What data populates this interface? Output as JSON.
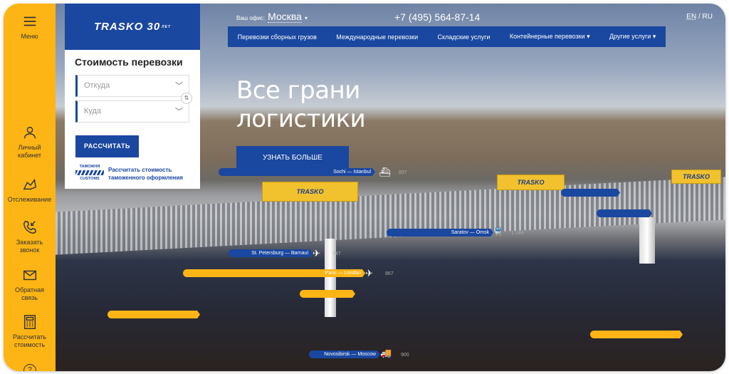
{
  "sidebar": {
    "menu": "Меню",
    "items": [
      {
        "label": "Личный кабинет",
        "icon": "user-icon"
      },
      {
        "label": "Отслеживание",
        "icon": "map-icon"
      },
      {
        "label": "Заказать звонок",
        "icon": "phone-icon"
      },
      {
        "label": "Обратная связь",
        "icon": "mail-icon"
      },
      {
        "label": "Рассчитать стоимость",
        "icon": "calculator-icon"
      }
    ],
    "help": "?"
  },
  "panel": {
    "logo": "TRASKO 30",
    "logo_sub": "ЛЕТ",
    "title": "Стоимость перевозки",
    "from_placeholder": "Откуда",
    "to_placeholder": "Куда",
    "calc_button": "РАССЧИТАТЬ",
    "customs_top": "ТАМОЖНЯ",
    "customs_bottom": "CUSTOMS",
    "customs_link": "Рассчитать стоимость таможенного оформления"
  },
  "header": {
    "office_label": "Ваш офис:",
    "office": "Москва",
    "phone": "+7 (495) 564-87-14",
    "lang_en": "EN",
    "lang_ru": "RU",
    "nav": [
      "Перевозки сборных грузов",
      "Международные перевозки",
      "Складские услуги",
      "Контейнерные перевозки",
      "Другие услуги"
    ]
  },
  "hero": {
    "title_line1": "Все грани",
    "title_line2": "логистики",
    "button": "УЗНАТЬ БОЛЬШЕ"
  },
  "routes": [
    {
      "label": "Sochi — Istanbul",
      "value": "897",
      "transport": "ship",
      "color": "#1a47a0"
    },
    {
      "label": "Saratov — Omsk",
      "value": "1 144",
      "transport": "train",
      "color": "#1a47a0"
    },
    {
      "label": "St. Petersburg — Barnaul",
      "value": "747",
      "transport": "plane",
      "color": "#1a47a0"
    },
    {
      "label": "Paris — London",
      "value": "867",
      "transport": "plane",
      "color": "#fdb515"
    },
    {
      "label": "Novosibirsk — Moscow",
      "value": "900",
      "transport": "truck",
      "color": "#1a47a0"
    }
  ],
  "truck_brand": "TRASKO",
  "colors": {
    "accent": "#fdb515",
    "brand": "#1a47a0"
  }
}
